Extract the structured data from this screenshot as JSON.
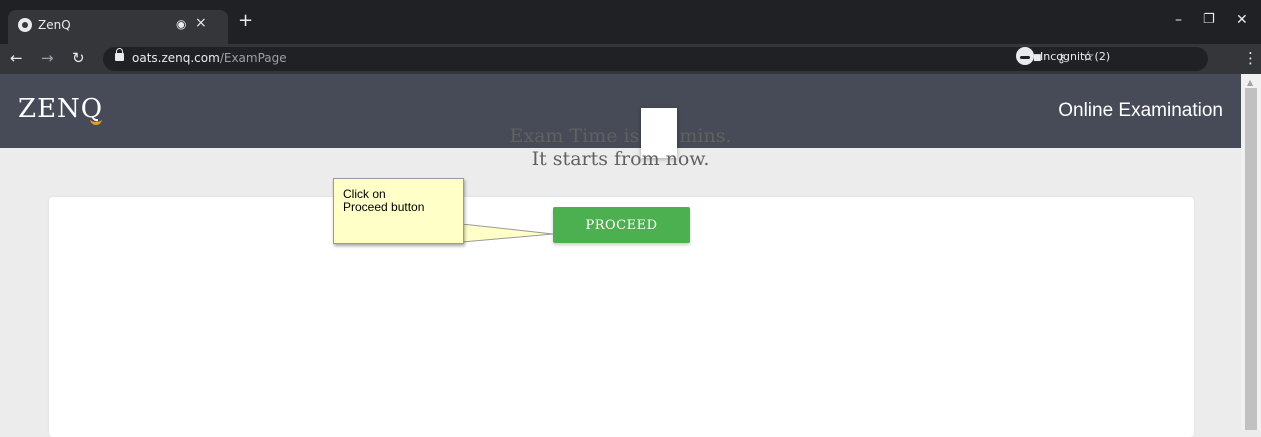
{
  "browser": {
    "tab": {
      "title": "ZenQ",
      "audio_icon": "◉",
      "close_icon": "×"
    },
    "new_tab_icon": "+",
    "window_controls": {
      "minimize": "–",
      "restore": "❐",
      "close": "✕"
    },
    "nav": {
      "back": "←",
      "forward": "→",
      "reload": "↻"
    },
    "address": {
      "domain": "oats.zenq.com",
      "path": "/ExamPage"
    },
    "omnibox_icons": {
      "camera": "■",
      "key": "⚷",
      "star": "☆"
    },
    "incognito": {
      "label": "Incognito (2)"
    },
    "menu_icon": "⋮"
  },
  "header": {
    "logo_text": "ZEN",
    "logo_q": "Q",
    "title": "Online Examination"
  },
  "main": {
    "exam_time_prefix": "Exam Time is",
    "exam_time_value": "",
    "exam_time_suffix": "mins.",
    "starts_text": "It starts from now.",
    "proceed_label": "PROCEED"
  },
  "callout": {
    "text": "Click on\nProceed button"
  },
  "colors": {
    "header_bg": "#464b57",
    "proceed_bg": "#4caf50",
    "callout_bg": "#ffffc8",
    "logo_accent": "#e69a2c"
  }
}
